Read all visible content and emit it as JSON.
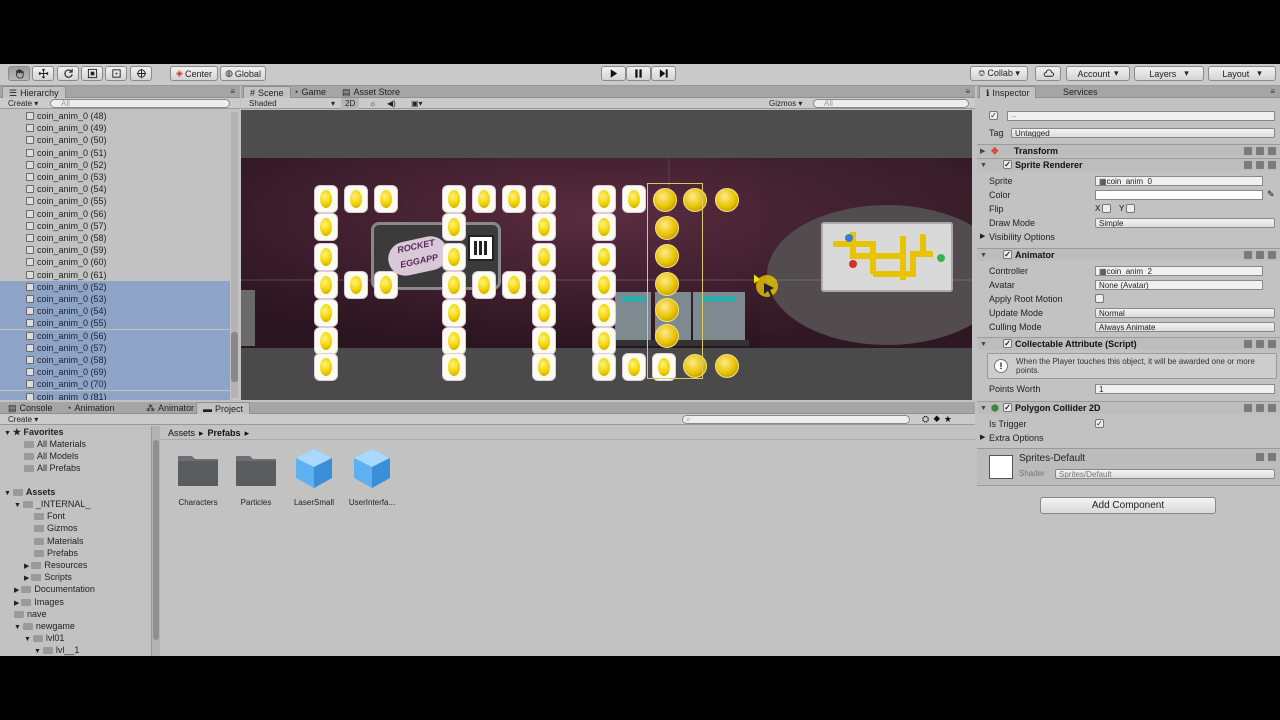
{
  "toolbar": {
    "center": "Center",
    "global": "Global",
    "collab": "Collab ▾",
    "account": "Account",
    "layers": "Layers",
    "layout": "Layout"
  },
  "hierarchy": {
    "tab": "Hierarchy",
    "create": "Create ▾",
    "search_placeholder": "All",
    "items": [
      "coin_anim_0 (48)",
      "coin_anim_0 (49)",
      "coin_anim_0 (50)",
      "coin_anim_0 (51)",
      "coin_anim_0 (52)",
      "coin_anim_0 (53)",
      "coin_anim_0 (54)",
      "coin_anim_0 (55)",
      "coin_anim_0 (56)",
      "coin_anim_0 (57)",
      "coin_anim_0 (58)",
      "coin_anim_0 (59)",
      "coin_anim_0 (60)",
      "coin_anim_0 (61)",
      "coin_anim_0 (52)",
      "coin_anim_0 (53)",
      "coin_anim_0 (54)",
      "coin_anim_0 (55)",
      "coin_anim_0 (56)",
      "coin_anim_0 (57)",
      "coin_anim_0 (58)",
      "coin_anim_0 (69)",
      "coin_anim_0 (70)",
      "coin_anim_0 (81)"
    ],
    "selected_from": 14
  },
  "scene": {
    "tabs": [
      "Scene",
      "Game",
      "Asset Store"
    ],
    "shading": "Shaded",
    "mode_2d": "2D",
    "gizmos": "Gizmos",
    "search_placeholder": "All",
    "sign_text": "ROCKET EGGAPP"
  },
  "project": {
    "tabs": [
      "Console",
      "Animation",
      "Animator",
      "Project"
    ],
    "create": "Create ▾",
    "favorites": {
      "label": "Favorites",
      "items": [
        "All Materials",
        "All Models",
        "All Prefabs"
      ]
    },
    "assets_label": "Assets",
    "tree": [
      "_INTERNAL_",
      "Font",
      "Gizmos",
      "Materials",
      "Prefabs",
      "Resources",
      "Scripts",
      "Documentation",
      "Images",
      "nave",
      "newgame",
      "lvl01",
      "lvl__1"
    ],
    "breadcrumb": [
      "Assets",
      "Prefabs"
    ],
    "files": [
      {
        "name": "Characters",
        "kind": "folder"
      },
      {
        "name": "Particles",
        "kind": "folder"
      },
      {
        "name": "LaserSmall",
        "kind": "prefab"
      },
      {
        "name": "UserInterfa...",
        "kind": "prefab"
      }
    ]
  },
  "inspector": {
    "tabs": [
      "Inspector",
      "Services"
    ],
    "name_value": "--",
    "tag_label": "Tag",
    "tag_value": "Untagged",
    "transform": "Transform",
    "sprite_renderer": {
      "title": "Sprite Renderer",
      "sprite_label": "Sprite",
      "sprite_value": "coin_anim_0",
      "color_label": "Color",
      "flip_label": "Flip",
      "flip_x": "X",
      "flip_y": "Y",
      "draw_mode_label": "Draw Mode",
      "draw_mode_value": "Simple",
      "visibility": "Visibility Options"
    },
    "animator": {
      "title": "Animator",
      "controller_label": "Controller",
      "controller_value": "coin_anim_2",
      "avatar_label": "Avatar",
      "avatar_value": "None (Avatar)",
      "root_motion_label": "Apply Root Motion",
      "update_mode_label": "Update Mode",
      "update_mode_value": "Normal",
      "culling_label": "Culling Mode",
      "culling_value": "Always Animate"
    },
    "collectable": {
      "title": "Collectable Attribute (Script)",
      "info": "When the Player touches this object, it will be awarded one or more points.",
      "points_label": "Points Worth",
      "points_value": "1"
    },
    "collider": {
      "title": "Polygon Collider 2D",
      "trigger_label": "Is Trigger",
      "extra": "Extra Options"
    },
    "material": {
      "name": "Sprites-Default",
      "shader_label": "Shader",
      "shader_value": "Sprites/Default"
    },
    "add_component": "Add Component"
  }
}
